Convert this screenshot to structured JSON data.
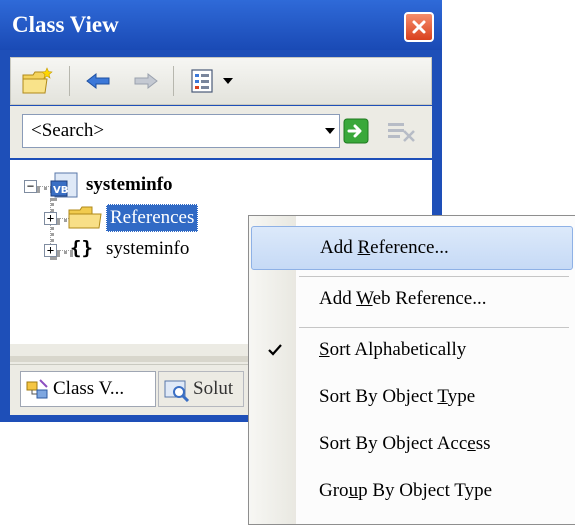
{
  "window": {
    "title": "Class View",
    "accent": "#1e4fb8",
    "close_color": "#d9411e"
  },
  "toolbar": {
    "items": [
      "new-folder-icon",
      "back-arrow-icon",
      "forward-arrow-icon",
      "settings-menu-icon",
      "dropdown-arrow-icon"
    ]
  },
  "search": {
    "value": "<Search>"
  },
  "tree": {
    "root": {
      "label": "systeminfo",
      "icon": "vb-project-icon",
      "expanded": true
    },
    "children": [
      {
        "label": "References",
        "icon": "folder-icon",
        "selected": true
      },
      {
        "label": "systeminfo",
        "icon": "namespace-braces-icon"
      }
    ]
  },
  "tabs": [
    {
      "label": "Class V...",
      "icon": "class-view-icon"
    },
    {
      "label": "Solut",
      "icon": "solution-explorer-icon"
    }
  ],
  "menu": {
    "items": [
      {
        "label_pre": "Add ",
        "label_mn": "R",
        "label_post": "eference...",
        "highlighted": true,
        "checked": false
      },
      {
        "label_pre": "Add ",
        "label_mn": "W",
        "label_post": "eb Reference...",
        "highlighted": false,
        "checked": false
      },
      {
        "label_pre": "",
        "label_mn": "S",
        "label_post": "ort Alphabetically",
        "highlighted": false,
        "checked": true
      },
      {
        "label_pre": "Sort By Object ",
        "label_mn": "T",
        "label_post": "ype",
        "highlighted": false,
        "checked": false
      },
      {
        "label_pre": "Sort By Object Acc",
        "label_mn": "e",
        "label_post": "ss",
        "highlighted": false,
        "checked": false
      },
      {
        "label_pre": "Gro",
        "label_mn": "u",
        "label_post": "p By Object Type",
        "highlighted": false,
        "checked": false
      }
    ]
  }
}
